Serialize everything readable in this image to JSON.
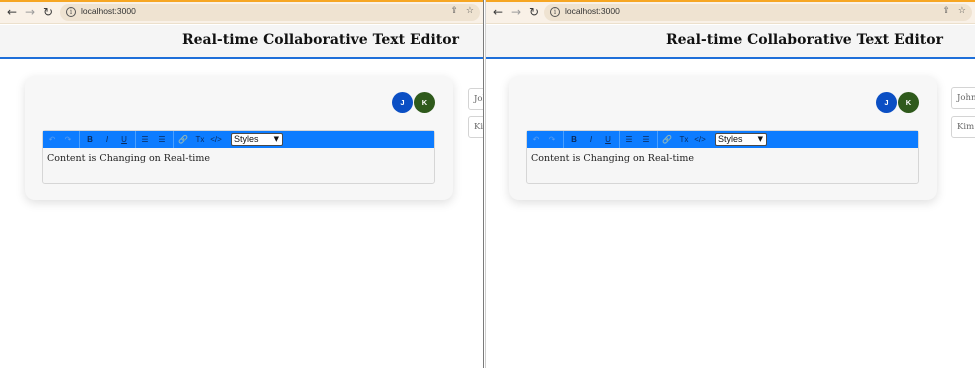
{
  "browser": {
    "url": "localhost:3000",
    "back_icon": "arrow-left-icon",
    "forward_icon": "arrow-right-icon",
    "reload_icon": "reload-icon",
    "info_icon": "info-icon",
    "share_icon": "share-icon",
    "bookmark_icon": "star-icon",
    "accent_color": "#f6a623"
  },
  "app": {
    "title": "Real-time Collaborative Text Editor",
    "header_border_color": "#1e6fd9"
  },
  "avatars": [
    {
      "initial": "J",
      "color": "#0b4fc4"
    },
    {
      "initial": "K",
      "color": "#2f5a1c"
    }
  ],
  "toolbar": {
    "color": "#0d7cff",
    "undo": "↶",
    "redo": "↷",
    "bold": "B",
    "italic": "I",
    "underline": "U",
    "ordered_list": "☰",
    "bullet_list": "☰",
    "link": "🔗",
    "clear_format": "Tx",
    "code": "</>",
    "styles_select": "Styles"
  },
  "editor": {
    "content": "Content is Changing on Real-time"
  },
  "windows": {
    "left": {
      "users": [
        "Joh",
        "Kim"
      ]
    },
    "right": {
      "users": [
        "John",
        "Kim j"
      ]
    }
  }
}
